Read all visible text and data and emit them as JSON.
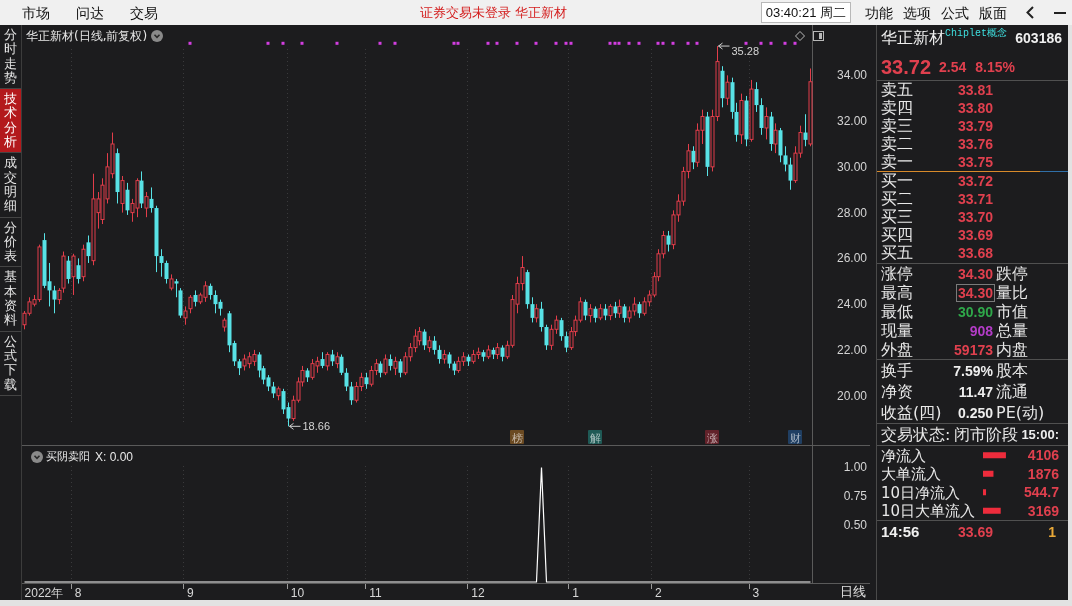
{
  "menu_bar": {
    "items": [
      "市场",
      "问达",
      "交易"
    ],
    "notice": "证券交易未登录",
    "stock": "华正新材",
    "clock": "03:40:21 周二",
    "right_items": [
      "功能",
      "选项",
      "公式",
      "版面"
    ]
  },
  "side_tabs": [
    {
      "label": "分时走势",
      "selected": false
    },
    {
      "label": "技术分析",
      "selected": true
    },
    {
      "label": "成交明细",
      "selected": false
    },
    {
      "label": "分价表",
      "selected": false
    },
    {
      "label": "基本资料",
      "selected": false
    },
    {
      "label": "公式下载",
      "selected": false
    }
  ],
  "price_chart": {
    "tag_colors": [
      {
        "color": "#6b4a22"
      },
      {
        "color": "#1f5a56"
      },
      {
        "color": "#62222a"
      },
      {
        "color": "#203f63"
      }
    ],
    "chart_data": [
      {
        "type": "candlestick",
        "title": "华正新材(日线,前复权)",
        "ylim": [
          17.8,
          36.2
        ],
        "yticks": [
          {
            "value": 20,
            "label": "20.00"
          },
          {
            "value": 22,
            "label": "22.00"
          },
          {
            "value": 24,
            "label": "24.00"
          },
          {
            "value": 26,
            "label": "26.00"
          },
          {
            "value": 28,
            "label": "28.00"
          },
          {
            "value": 30,
            "label": "30.00"
          },
          {
            "value": 32,
            "label": "32.00"
          },
          {
            "value": 34,
            "label": "34.00"
          }
        ],
        "categories": [
          null,
          null,
          null,
          null,
          null,
          null,
          null,
          null,
          null,
          null,
          null,
          null,
          null,
          null,
          null,
          null,
          null,
          null,
          null,
          null,
          null,
          null,
          null,
          null,
          null,
          null,
          null,
          null,
          null,
          null,
          null,
          null,
          null,
          null,
          null,
          null,
          null,
          null,
          null,
          null,
          null,
          null,
          null,
          null,
          null,
          null,
          null,
          null,
          null,
          null,
          null,
          null,
          null,
          null,
          null,
          null,
          null,
          null,
          null,
          null,
          null,
          null,
          null,
          null,
          null,
          null,
          null,
          null,
          null,
          null,
          null,
          null,
          null,
          null,
          null,
          null,
          null,
          null,
          null,
          null,
          null,
          null,
          null,
          null,
          null,
          null,
          null,
          null,
          null,
          null,
          null,
          null,
          null,
          null,
          null,
          null,
          null,
          null,
          null,
          null,
          null,
          "榜",
          null,
          null,
          null,
          null,
          null,
          null,
          null,
          null,
          null,
          null,
          null,
          null,
          null,
          null,
          null,
          "解",
          null,
          null,
          null,
          null,
          null,
          null,
          null,
          null,
          null,
          null,
          null,
          null,
          null,
          null,
          null,
          null,
          null,
          null,
          null,
          null,
          null,
          null,
          null,
          "涨",
          null,
          null,
          null,
          null,
          null,
          null,
          null,
          null,
          null,
          null,
          null,
          null,
          null,
          null,
          null,
          null,
          "财",
          null,
          null,
          null
        ],
        "ohlc": [
          [
            23.1,
            23.7,
            22.9,
            23.6
          ],
          [
            23.6,
            24.3,
            23.5,
            24.1
          ],
          [
            24.0,
            24.4,
            23.9,
            24.2
          ],
          [
            24.2,
            26.6,
            24.1,
            26.5
          ],
          [
            26.8,
            27.1,
            24.7,
            24.8
          ],
          [
            25.0,
            25.8,
            23.9,
            24.6
          ],
          [
            24.6,
            24.8,
            23.6,
            24.2
          ],
          [
            24.2,
            24.7,
            24.0,
            24.6
          ],
          [
            24.7,
            26.3,
            24.5,
            26.1
          ],
          [
            25.9,
            26.1,
            24.9,
            25.1
          ],
          [
            25.2,
            26.2,
            24.4,
            26.1
          ],
          [
            25.7,
            26.0,
            24.9,
            25.1
          ],
          [
            25.2,
            26.6,
            25.0,
            26.4
          ],
          [
            26.7,
            27.0,
            25.8,
            26.1
          ],
          [
            25.9,
            29.7,
            25.7,
            28.6
          ],
          [
            28.0,
            28.9,
            27.3,
            28.6
          ],
          [
            27.7,
            29.5,
            27.5,
            29.2
          ],
          [
            28.6,
            30.6,
            28.4,
            30.0
          ],
          [
            29.7,
            31.5,
            29.5,
            31.0
          ],
          [
            30.6,
            30.8,
            28.4,
            28.9
          ],
          [
            28.4,
            29.6,
            28.0,
            29.4
          ],
          [
            29.0,
            29.3,
            27.9,
            28.1
          ],
          [
            28.0,
            28.6,
            27.6,
            28.4
          ],
          [
            28.2,
            29.5,
            27.8,
            29.4
          ],
          [
            29.4,
            29.8,
            28.2,
            28.4
          ],
          [
            28.2,
            28.9,
            27.8,
            28.7
          ],
          [
            28.6,
            29.1,
            28.0,
            28.2
          ],
          [
            28.2,
            28.3,
            25.4,
            26.1
          ],
          [
            26.1,
            26.4,
            25.2,
            25.8
          ],
          [
            25.8,
            25.9,
            24.9,
            25.1
          ],
          [
            24.7,
            25.3,
            24.6,
            25.1
          ],
          [
            25.0,
            25.1,
            24.3,
            24.9
          ],
          [
            24.6,
            24.7,
            23.4,
            23.5
          ],
          [
            23.4,
            23.9,
            23.1,
            23.7
          ],
          [
            23.8,
            24.4,
            23.6,
            24.3
          ],
          [
            24.4,
            24.6,
            23.9,
            24.1
          ],
          [
            24.1,
            24.5,
            24.0,
            24.4
          ],
          [
            24.3,
            25.0,
            24.1,
            24.8
          ],
          [
            24.8,
            24.9,
            24.2,
            24.4
          ],
          [
            24.4,
            24.6,
            23.6,
            24.0
          ],
          [
            24.1,
            24.2,
            23.5,
            23.8
          ],
          [
            23.0,
            23.4,
            22.8,
            23.3
          ],
          [
            23.6,
            23.7,
            21.9,
            22.2
          ],
          [
            22.3,
            22.4,
            21.3,
            21.5
          ],
          [
            21.5,
            21.6,
            20.9,
            21.2
          ],
          [
            21.3,
            21.8,
            21.1,
            21.6
          ],
          [
            21.4,
            21.9,
            21.2,
            21.7
          ],
          [
            21.5,
            22.0,
            21.3,
            21.8
          ],
          [
            21.8,
            21.9,
            20.8,
            21.1
          ],
          [
            21.2,
            21.3,
            20.5,
            20.7
          ],
          [
            20.8,
            20.9,
            20.2,
            20.4
          ],
          [
            20.4,
            20.6,
            19.9,
            20.1
          ],
          [
            20.0,
            20.4,
            19.8,
            20.3
          ],
          [
            20.2,
            20.3,
            19.2,
            19.4
          ],
          [
            19.5,
            19.7,
            18.66,
            19.0
          ],
          [
            19.0,
            20.0,
            18.9,
            19.8
          ],
          [
            19.8,
            20.8,
            19.7,
            20.6
          ],
          [
            20.6,
            21.3,
            20.4,
            21.1
          ],
          [
            21.1,
            21.2,
            20.6,
            20.8
          ],
          [
            20.8,
            21.6,
            20.7,
            21.4
          ],
          [
            21.3,
            21.7,
            21.0,
            21.5
          ],
          [
            21.6,
            21.9,
            21.2,
            21.3
          ],
          [
            21.3,
            21.9,
            21.1,
            21.8
          ],
          [
            21.8,
            22.0,
            21.3,
            21.5
          ],
          [
            21.4,
            21.9,
            21.2,
            21.7
          ],
          [
            21.7,
            21.8,
            20.9,
            21.0
          ],
          [
            21.0,
            21.2,
            20.2,
            20.4
          ],
          [
            20.4,
            20.6,
            19.6,
            19.8
          ],
          [
            19.8,
            20.6,
            19.7,
            20.4
          ],
          [
            20.4,
            21.0,
            20.2,
            20.8
          ],
          [
            20.8,
            21.0,
            20.3,
            20.5
          ],
          [
            20.5,
            21.3,
            20.4,
            21.1
          ],
          [
            21.1,
            21.6,
            20.9,
            21.4
          ],
          [
            21.4,
            21.5,
            20.8,
            21.0
          ],
          [
            21.0,
            21.8,
            20.9,
            21.6
          ],
          [
            21.6,
            21.8,
            21.1,
            21.3
          ],
          [
            21.2,
            21.7,
            20.9,
            21.5
          ],
          [
            21.5,
            21.6,
            20.8,
            21.0
          ],
          [
            21.0,
            21.9,
            20.9,
            21.7
          ],
          [
            21.7,
            22.3,
            21.5,
            22.1
          ],
          [
            22.1,
            22.9,
            21.9,
            22.6
          ],
          [
            22.4,
            23.0,
            22.2,
            22.8
          ],
          [
            22.8,
            22.9,
            22.0,
            22.2
          ],
          [
            22.1,
            22.6,
            21.9,
            22.4
          ],
          [
            22.4,
            22.6,
            21.8,
            22.0
          ],
          [
            22.0,
            22.2,
            21.4,
            21.6
          ],
          [
            21.6,
            22.0,
            21.4,
            21.8
          ],
          [
            21.8,
            21.9,
            21.2,
            21.4
          ],
          [
            21.4,
            21.5,
            20.9,
            21.1
          ],
          [
            21.1,
            21.7,
            21.0,
            21.5
          ],
          [
            21.5,
            21.9,
            21.3,
            21.7
          ],
          [
            21.7,
            21.8,
            21.3,
            21.5
          ],
          [
            21.5,
            22.0,
            21.4,
            21.8
          ],
          [
            21.8,
            22.1,
            21.6,
            21.9
          ],
          [
            21.9,
            22.0,
            21.5,
            21.7
          ],
          [
            21.7,
            22.2,
            21.6,
            22.0
          ],
          [
            22.0,
            22.1,
            21.6,
            21.8
          ],
          [
            21.8,
            22.3,
            21.6,
            22.1
          ],
          [
            22.1,
            22.2,
            21.5,
            21.7
          ],
          [
            21.7,
            22.4,
            21.6,
            22.2
          ],
          [
            22.2,
            24.4,
            22.1,
            24.2
          ],
          [
            24.0,
            25.2,
            23.6,
            24.9
          ],
          [
            24.9,
            26.1,
            24.6,
            25.6
          ],
          [
            25.4,
            25.5,
            23.8,
            24.0
          ],
          [
            24.0,
            24.3,
            23.2,
            23.4
          ],
          [
            23.4,
            24.0,
            23.2,
            23.8
          ],
          [
            23.8,
            24.1,
            22.8,
            23.0
          ],
          [
            23.0,
            23.1,
            22.0,
            22.2
          ],
          [
            22.2,
            23.1,
            22.0,
            22.9
          ],
          [
            22.9,
            23.5,
            22.7,
            23.3
          ],
          [
            23.3,
            23.4,
            22.4,
            22.6
          ],
          [
            22.6,
            22.8,
            21.9,
            22.1
          ],
          [
            22.1,
            23.0,
            22.0,
            22.8
          ],
          [
            22.8,
            23.5,
            22.6,
            23.3
          ],
          [
            23.3,
            24.3,
            23.2,
            24.1
          ],
          [
            24.1,
            24.2,
            23.3,
            23.5
          ],
          [
            23.5,
            24.0,
            23.2,
            23.8
          ],
          [
            23.8,
            23.9,
            23.2,
            23.4
          ],
          [
            23.4,
            24.0,
            23.3,
            23.8
          ],
          [
            23.8,
            24.0,
            23.3,
            23.5
          ],
          [
            23.5,
            24.0,
            23.3,
            23.9
          ],
          [
            23.9,
            24.1,
            23.4,
            23.6
          ],
          [
            23.6,
            24.2,
            23.4,
            23.9
          ],
          [
            23.9,
            24.0,
            23.2,
            23.4
          ],
          [
            23.4,
            23.9,
            23.2,
            23.7
          ],
          [
            23.7,
            24.3,
            23.5,
            24.0
          ],
          [
            24.0,
            24.1,
            23.4,
            23.6
          ],
          [
            23.6,
            24.3,
            23.5,
            24.1
          ],
          [
            24.1,
            24.6,
            23.9,
            24.4
          ],
          [
            24.4,
            25.4,
            24.3,
            25.2
          ],
          [
            25.2,
            26.4,
            25.0,
            26.2
          ],
          [
            26.2,
            27.2,
            26.0,
            27.0
          ],
          [
            27.0,
            27.2,
            26.3,
            26.6
          ],
          [
            26.6,
            28.1,
            26.4,
            27.9
          ],
          [
            27.9,
            28.8,
            27.6,
            28.5
          ],
          [
            28.5,
            30.0,
            28.3,
            29.8
          ],
          [
            29.8,
            31.0,
            29.5,
            30.7
          ],
          [
            30.7,
            30.9,
            29.9,
            30.2
          ],
          [
            30.2,
            31.9,
            30.0,
            31.6
          ],
          [
            31.6,
            32.5,
            31.0,
            32.2
          ],
          [
            32.2,
            32.4,
            29.6,
            30.0
          ],
          [
            30.0,
            32.5,
            29.8,
            32.2
          ],
          [
            32.2,
            35.28,
            32.0,
            34.6
          ],
          [
            34.2,
            34.4,
            32.6,
            33.0
          ],
          [
            33.0,
            34.0,
            32.7,
            33.7
          ],
          [
            33.7,
            33.9,
            32.1,
            32.4
          ],
          [
            32.4,
            32.8,
            31.1,
            31.4
          ],
          [
            31.4,
            33.2,
            31.0,
            32.9
          ],
          [
            32.9,
            33.1,
            30.9,
            31.2
          ],
          [
            31.2,
            33.8,
            31.1,
            33.4
          ],
          [
            33.4,
            33.7,
            32.4,
            32.7
          ],
          [
            32.7,
            33.0,
            31.4,
            31.7
          ],
          [
            31.7,
            32.6,
            31.2,
            32.2
          ],
          [
            32.2,
            32.4,
            30.7,
            31.0
          ],
          [
            31.0,
            31.9,
            30.6,
            31.6
          ],
          [
            31.6,
            31.7,
            30.2,
            30.5
          ],
          [
            30.5,
            30.9,
            29.8,
            30.1
          ],
          [
            30.1,
            30.4,
            29.0,
            29.4
          ],
          [
            29.4,
            30.9,
            29.3,
            30.6
          ],
          [
            30.6,
            31.8,
            30.4,
            31.5
          ],
          [
            31.5,
            32.3,
            30.9,
            31.18
          ],
          [
            31.0,
            34.3,
            30.9,
            33.72
          ]
        ],
        "series": [
          {
            "type": "scatter",
            "marker": "square",
            "color": "#d23ee0",
            "values": [
              null,
              null,
              null,
              null,
              null,
              null,
              null,
              null,
              null,
              null,
              null,
              null,
              null,
              null,
              null,
              null,
              null,
              null,
              null,
              null,
              null,
              null,
              null,
              null,
              null,
              null,
              null,
              null,
              null,
              null,
              null,
              null,
              null,
              null,
              35.4,
              null,
              null,
              null,
              null,
              null,
              null,
              null,
              null,
              null,
              null,
              null,
              null,
              null,
              null,
              null,
              35.4,
              null,
              null,
              35.4,
              null,
              null,
              null,
              35.4,
              null,
              null,
              null,
              null,
              null,
              null,
              35.4,
              null,
              null,
              null,
              null,
              null,
              null,
              null,
              null,
              35.4,
              null,
              null,
              35.4,
              null,
              null,
              null,
              null,
              null,
              null,
              null,
              null,
              null,
              null,
              null,
              35.4,
              35.4,
              null,
              null,
              null,
              null,
              null,
              35.4,
              null,
              35.4,
              null,
              null,
              null,
              35.4,
              null,
              null,
              null,
              35.4,
              null,
              null,
              null,
              35.4,
              null,
              35.4,
              35.4,
              null,
              null,
              null,
              null,
              null,
              null,
              null,
              35.4,
              35.4,
              35.4,
              null,
              35.4,
              null,
              35.4,
              null,
              null,
              null,
              35.4,
              35.4,
              null,
              35.4,
              null,
              null,
              35.4,
              null,
              35.4,
              null,
              null,
              null,
              null,
              null,
              null,
              null,
              null,
              null,
              35.4,
              null,
              null,
              35.4,
              null,
              35.4,
              null,
              null,
              35.4,
              null,
              35.4,
              null,
              null,
              null
            ]
          }
        ],
        "annotations": [
          "35.28",
          "18.66"
        ]
      }
    ]
  },
  "indicator_chart": {
    "reading": "X: 0.00",
    "chart_data": [
      {
        "type": "line",
        "title": "买阴卖阳",
        "color": "#ffffff",
        "ylim": [
          0,
          1.17
        ],
        "yticks": [
          {
            "value": 1,
            "label": "1.00"
          },
          {
            "value": 0.75,
            "label": "0.75"
          },
          {
            "value": 0.5,
            "label": "0.50"
          }
        ],
        "categories": [
          null,
          null,
          null,
          null,
          "2022年",
          null,
          null,
          null,
          null,
          null,
          null,
          "8",
          null,
          null,
          null,
          null,
          null,
          null,
          null,
          null,
          null,
          null,
          null,
          null,
          null,
          null,
          null,
          null,
          null,
          null,
          null,
          null,
          null,
          null,
          "9",
          null,
          null,
          null,
          null,
          null,
          null,
          null,
          null,
          null,
          null,
          null,
          null,
          null,
          null,
          null,
          null,
          null,
          null,
          null,
          null,
          null,
          "10",
          null,
          null,
          null,
          null,
          null,
          null,
          null,
          null,
          null,
          null,
          null,
          null,
          null,
          null,
          null,
          "11",
          null,
          null,
          null,
          null,
          null,
          null,
          null,
          null,
          null,
          null,
          null,
          null,
          null,
          null,
          null,
          null,
          null,
          null,
          null,
          null,
          "12",
          null,
          null,
          null,
          null,
          null,
          null,
          null,
          null,
          null,
          null,
          null,
          null,
          null,
          null,
          null,
          null,
          null,
          null,
          null,
          "1",
          null,
          null,
          null,
          null,
          null,
          null,
          null,
          null,
          null,
          null,
          null,
          null,
          null,
          null,
          null,
          null,
          "2",
          null,
          null,
          null,
          null,
          null,
          null,
          null,
          null,
          null,
          null,
          null,
          null,
          null,
          null,
          null,
          null,
          null,
          null,
          null,
          "3",
          null,
          null,
          null,
          null,
          null,
          null,
          null,
          null,
          null,
          null,
          null
        ],
        "values": [
          0,
          0,
          0,
          0,
          0,
          0,
          0,
          0,
          0,
          0,
          0,
          0,
          0,
          0,
          0,
          0,
          0,
          0,
          0,
          0,
          0,
          0,
          0,
          0,
          0,
          0,
          0,
          0,
          0,
          0,
          0,
          0,
          0,
          0,
          0,
          0,
          0,
          0,
          0,
          0,
          0,
          0,
          0,
          0,
          0,
          0,
          0,
          0,
          0,
          0,
          0,
          0,
          0,
          0,
          0,
          0,
          0,
          0,
          0,
          0,
          0,
          0,
          0,
          0,
          0,
          0,
          0,
          0,
          0,
          0,
          0,
          0,
          0,
          0,
          0,
          0,
          0,
          0,
          0,
          0,
          0,
          0,
          0,
          0,
          0,
          0,
          0,
          0,
          0,
          0,
          0,
          0,
          0,
          0,
          0,
          0,
          0,
          0,
          0,
          0,
          0,
          0,
          0,
          0,
          0,
          0,
          1,
          0,
          0,
          0,
          0,
          0,
          0,
          0,
          0,
          0,
          0,
          0,
          0,
          0,
          0,
          0,
          0,
          0,
          0,
          0,
          0,
          0,
          0,
          0,
          0,
          0,
          0,
          0,
          0,
          0,
          0,
          0,
          0,
          0,
          0,
          0,
          0,
          0,
          0,
          0,
          0,
          0,
          0,
          0,
          0,
          0,
          0,
          0,
          0,
          0,
          0,
          0,
          0,
          0,
          0,
          0
        ]
      }
    ]
  },
  "period_label": "日线",
  "quote_panel": {
    "name": "华正新材",
    "concept": "Chiplet概念",
    "code": "603186",
    "price": "33.72",
    "change": "2.54",
    "change_pct": "8.15%",
    "asks": [
      {
        "label": "卖五",
        "price": "33.81"
      },
      {
        "label": "卖四",
        "price": "33.80"
      },
      {
        "label": "卖三",
        "price": "33.79"
      },
      {
        "label": "卖二",
        "price": "33.76"
      },
      {
        "label": "卖一",
        "price": "33.75"
      }
    ],
    "bids": [
      {
        "label": "买一",
        "price": "33.72"
      },
      {
        "label": "买二",
        "price": "33.71"
      },
      {
        "label": "买三",
        "price": "33.70"
      },
      {
        "label": "买四",
        "price": "33.69"
      },
      {
        "label": "买五",
        "price": "33.68"
      }
    ],
    "limits": [
      {
        "label": "涨停",
        "value": "34.30",
        "color": "#e0404e",
        "outlined": false,
        "label2": "跌停"
      },
      {
        "label": "最高",
        "value": "34.30",
        "color": "#e0404e",
        "outlined": true,
        "label2": "量比"
      },
      {
        "label": "最低",
        "value": "30.90",
        "color": "#2fa84a",
        "outlined": false,
        "label2": "市值"
      },
      {
        "label": "现量",
        "value": "908",
        "color": "#b43cc8",
        "outlined": false,
        "label2": "总量"
      },
      {
        "label": "外盘",
        "value": "59173",
        "color": "#e0404e",
        "outlined": false,
        "label2": "内盘"
      }
    ],
    "fundamentals": [
      {
        "label": "换手",
        "value": "7.59%",
        "label2": "股本"
      },
      {
        "label": "净资",
        "value": "11.47",
        "label2": "流通"
      },
      {
        "label": "收益(四)",
        "value": "0.250",
        "label2": "PE(动)"
      }
    ],
    "trade_status": {
      "label": "交易状态:",
      "value": "闭市阶段",
      "time": "15:00:"
    },
    "flows": {
      "chart_data": [
        {
          "type": "bar",
          "orientation": "horizontal",
          "categories": [
            "净流入",
            "大单流入",
            "10日净流入",
            "10日大单流入"
          ],
          "values": [
            4106,
            1876,
            544.7,
            3169
          ],
          "value_labels": [
            "4106",
            "1876",
            "544.7",
            "3169"
          ],
          "color": "#ee2c3c",
          "xlim": [
            0,
            4300
          ]
        }
      ]
    },
    "ticks": [
      {
        "time": "14:56",
        "price": "33.69",
        "volume": "1"
      }
    ]
  }
}
